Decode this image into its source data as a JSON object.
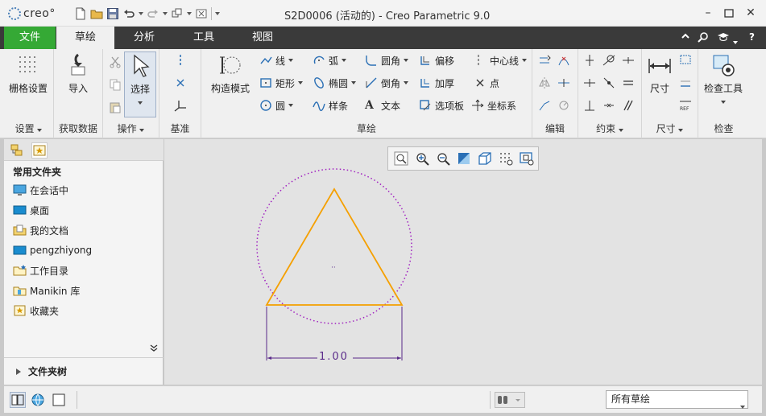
{
  "app": {
    "logo_text": "creo°",
    "window_title": "S2D0006 (活动的) - Creo Parametric 9.0"
  },
  "tabs": [
    {
      "label": "文件"
    },
    {
      "label": "草绘"
    },
    {
      "label": "分析"
    },
    {
      "label": "工具"
    },
    {
      "label": "视图"
    }
  ],
  "ribbon": {
    "settings": {
      "grid_label": "栅格设置",
      "group": "设置"
    },
    "get_data": {
      "import_label": "导入",
      "group": "获取数据"
    },
    "operations": {
      "select_label": "选择",
      "group": "操作"
    },
    "datum": {
      "group": "基准"
    },
    "sketch": {
      "construction_label": "构造模式",
      "line": "线",
      "arc": "弧",
      "fillet": "圆角",
      "offset": "偏移",
      "centerline": "中心线",
      "rectangle": "矩形",
      "ellipse": "椭圆",
      "chamfer": "倒角",
      "thicken": "加厚",
      "point": "点",
      "circle": "圆",
      "spline": "样条",
      "text": "文本",
      "palette": "选项板",
      "coord_sys": "坐标系",
      "group": "草绘"
    },
    "edit": {
      "group": "编辑"
    },
    "constrain": {
      "group": "约束"
    },
    "dimension": {
      "dim_label": "尺寸",
      "group": "尺寸"
    },
    "inspect": {
      "tools_label": "检查工具",
      "group": "检查"
    }
  },
  "navigator": {
    "heading": "常用文件夹",
    "items": [
      {
        "label": "在会话中",
        "icon": "monitor-icon"
      },
      {
        "label": "桌面",
        "icon": "desktop-icon"
      },
      {
        "label": "我的文档",
        "icon": "documents-icon"
      },
      {
        "label": "pengzhiyong",
        "icon": "user-folder-icon"
      },
      {
        "label": "工作目录",
        "icon": "working-dir-icon"
      },
      {
        "label": "Manikin 库",
        "icon": "library-icon"
      },
      {
        "label": "收藏夹",
        "icon": "favorites-icon"
      }
    ],
    "folder_tree": "文件夹树"
  },
  "sketch": {
    "dimension_value": "1.00",
    "colors": {
      "triangle": "#f5a000",
      "circle": "#a020c0",
      "dimension": "#5a2a8a"
    }
  },
  "statusbar": {
    "filter_value": "所有草绘"
  }
}
